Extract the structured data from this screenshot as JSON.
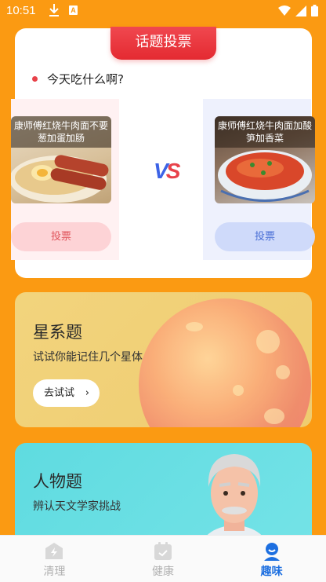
{
  "status": {
    "time": "10:51"
  },
  "vote": {
    "header": "话题投票",
    "question": "今天吃什么啊?",
    "left_option": "康师傅红烧牛肉面不要葱加蛋加肠",
    "right_option": "康师傅红烧牛肉面加酸笋加香菜",
    "left_button": "投票",
    "right_button": "投票",
    "vs_v": "V",
    "vs_s": "S"
  },
  "galaxy": {
    "title": "星系题",
    "subtitle": "试试你能记住几个星体",
    "button": "去试试",
    "chevron": "›"
  },
  "people": {
    "title": "人物题",
    "subtitle": "辨认天文学家挑战"
  },
  "tabs": [
    {
      "label": "清理",
      "icon": "lightning-icon",
      "active": false
    },
    {
      "label": "健康",
      "icon": "calendar-icon",
      "active": false
    },
    {
      "label": "趣味",
      "icon": "person-icon",
      "active": true
    }
  ],
  "colors": {
    "background": "#fb9a12",
    "accent_red": "#e42a31",
    "accent_blue": "#1d6fe0"
  }
}
